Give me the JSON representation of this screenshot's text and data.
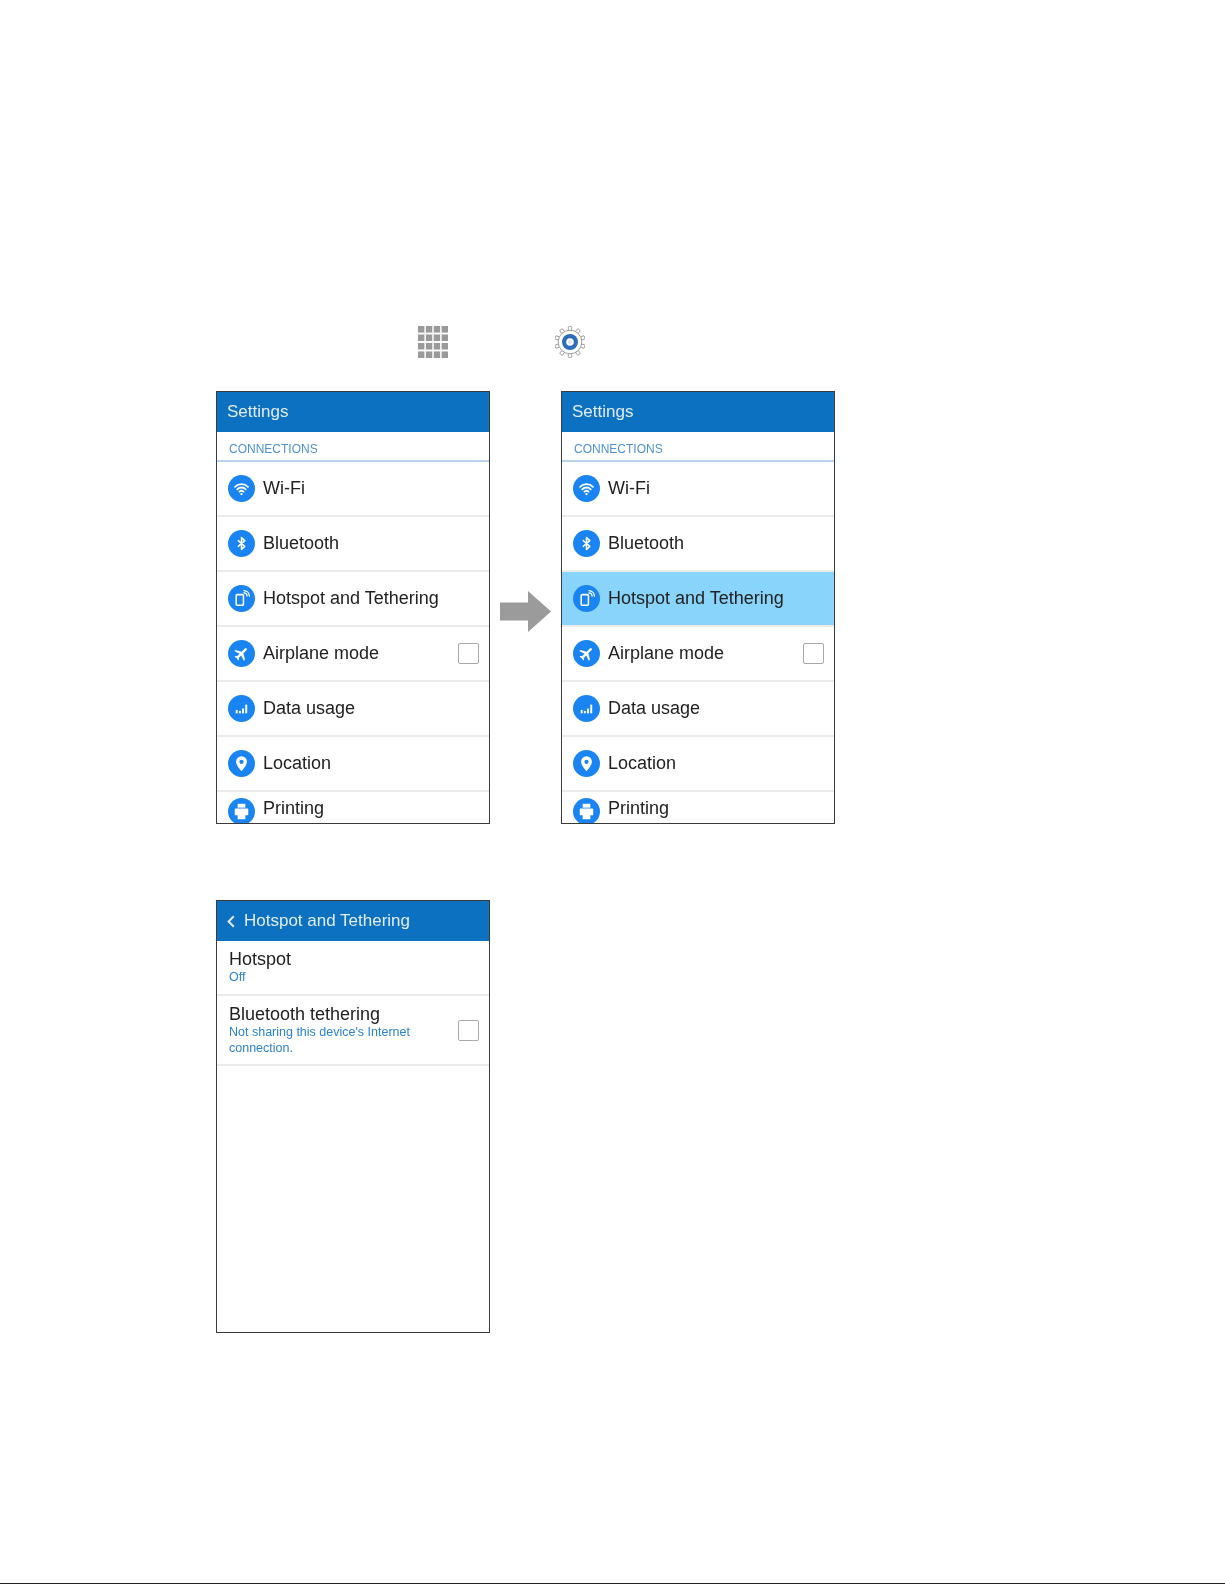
{
  "screens": [
    {
      "title": "Settings",
      "back": false,
      "section": "CONNECTIONS",
      "items": [
        {
          "label": "Wi-Fi",
          "kind": "link",
          "selected": false
        },
        {
          "label": "Bluetooth",
          "kind": "link",
          "selected": false
        },
        {
          "label": "Hotspot and Tethering",
          "kind": "link",
          "selected": false
        },
        {
          "label": "Airplane mode",
          "kind": "checkbox",
          "checked": false,
          "selected": false
        },
        {
          "label": "Data usage",
          "kind": "link",
          "selected": false
        },
        {
          "label": "Location",
          "kind": "link",
          "selected": false
        },
        {
          "label": "Printing",
          "kind": "link",
          "selected": false
        }
      ]
    },
    {
      "title": "Settings",
      "back": false,
      "section": "CONNECTIONS",
      "items": [
        {
          "label": "Wi-Fi",
          "kind": "link",
          "selected": false
        },
        {
          "label": "Bluetooth",
          "kind": "link",
          "selected": false
        },
        {
          "label": "Hotspot and Tethering",
          "kind": "link",
          "selected": true
        },
        {
          "label": "Airplane mode",
          "kind": "checkbox",
          "checked": false,
          "selected": false
        },
        {
          "label": "Data usage",
          "kind": "link",
          "selected": false
        },
        {
          "label": "Location",
          "kind": "link",
          "selected": false
        },
        {
          "label": "Printing",
          "kind": "link",
          "selected": false
        }
      ]
    }
  ],
  "detail_screen": {
    "title": "Hotspot and Tethering",
    "back": true,
    "items": [
      {
        "label": "Hotspot",
        "summary": "Off",
        "kind": "link"
      },
      {
        "label": "Bluetooth tethering",
        "summary": "Not sharing this device's Internet connection.",
        "kind": "checkbox",
        "checked": false
      }
    ]
  }
}
